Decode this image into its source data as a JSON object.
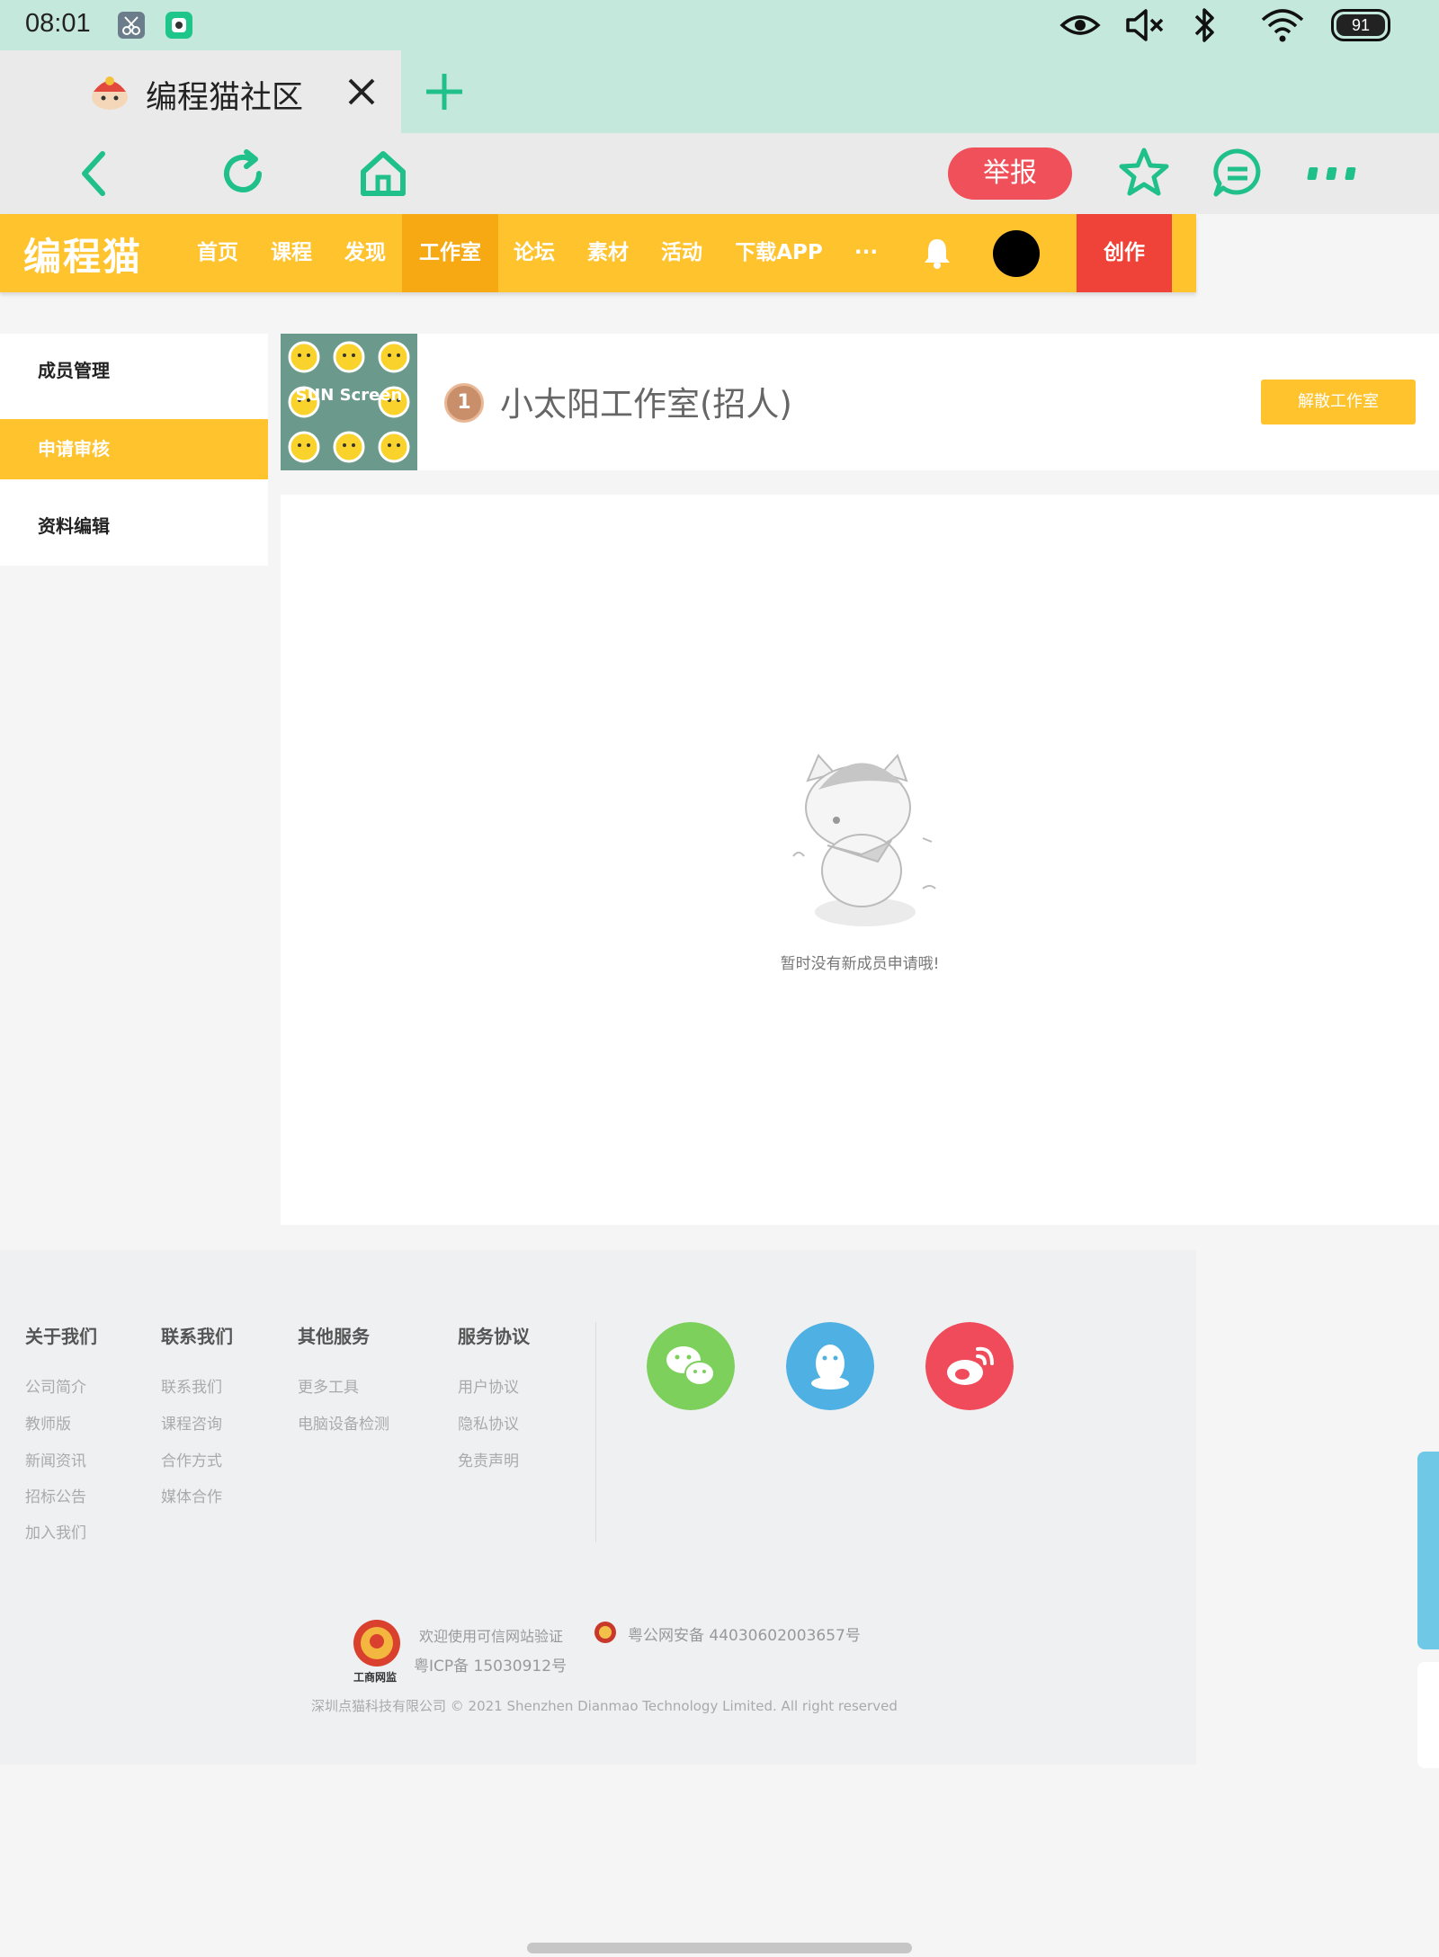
{
  "status_bar": {
    "time": "08:01",
    "battery": "91",
    "icons": [
      "scissors-icon",
      "app-badge-icon",
      "eye-icon",
      "mute-icon",
      "bluetooth-icon",
      "wifi-icon",
      "battery-icon"
    ]
  },
  "browser": {
    "tab_title": "编程猫社区",
    "report_label": "举报"
  },
  "site": {
    "logo": "编程猫",
    "menu": [
      "首页",
      "课程",
      "发现",
      "工作室",
      "论坛",
      "素材",
      "活动",
      "下载APP",
      "···"
    ],
    "active_menu": "工作室",
    "create_label": "创作",
    "accent": "#fec32d",
    "accent_dark": "#f6a913",
    "create_color": "#ef4339"
  },
  "sidebar": {
    "items": [
      {
        "label": "成员管理",
        "active": false
      },
      {
        "label": "申请审核",
        "active": true
      },
      {
        "label": "资料编辑",
        "active": false
      }
    ]
  },
  "studio": {
    "thumb_text": "SUN Screen",
    "level": "1",
    "name": "小太阳工作室(招人)",
    "dissolve_label": "解散工作室"
  },
  "main": {
    "empty_text": "暂时没有新成员申请哦!"
  },
  "footer": {
    "columns": [
      {
        "title": "关于我们",
        "links": [
          "公司简介",
          "教师版",
          "新闻资讯",
          "招标公告",
          "加入我们"
        ]
      },
      {
        "title": "联系我们",
        "links": [
          "联系我们",
          "课程咨询",
          "合作方式",
          "媒体合作"
        ]
      },
      {
        "title": "其他服务",
        "links": [
          "更多工具",
          "电脑设备检测"
        ]
      },
      {
        "title": "服务协议",
        "links": [
          "用户协议",
          "隐私协议",
          "免责声明"
        ]
      }
    ],
    "social": [
      "wechat-icon",
      "qq-icon",
      "weibo-icon"
    ],
    "trust_text": "欢迎使用可信网站验证",
    "badge_text": "工商网监",
    "icp": "粤ICP备 15030912号",
    "police": "粤公网安备 44030602003657号",
    "copyright": "深圳点猫科技有限公司   © 2021 Shenzhen Dianmao Technology Limited. All right reserved"
  }
}
